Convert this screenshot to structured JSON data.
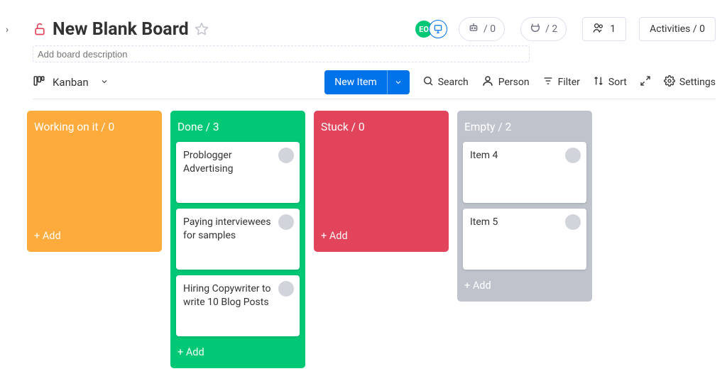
{
  "collapse": {
    "glyph": "›"
  },
  "header": {
    "title": "New Blank Board",
    "description_placeholder": "Add board description",
    "avatars": [
      {
        "initials": "EO"
      },
      {
        "icon": true
      }
    ],
    "automation_count": "/ 0",
    "integration_count": "/ 2",
    "members": {
      "label": "1"
    },
    "activities": {
      "label": "Activities / 0"
    }
  },
  "toolbar": {
    "view_label": "Kanban",
    "new_item_label": "New Item",
    "search_label": "Search",
    "person_label": "Person",
    "filter_label": "Filter",
    "sort_label": "Sort",
    "settings_label": "Settings"
  },
  "columns": [
    {
      "title": "Working on it / 0",
      "color": "col-orange",
      "cards": [],
      "add_label": "+ Add"
    },
    {
      "title": "Done / 3",
      "color": "col-green",
      "cards": [
        {
          "text": "Problogger Advertising"
        },
        {
          "text": "Paying interviewees for samples"
        },
        {
          "text": "Hiring Copywriter to write 10 Blog Posts"
        }
      ],
      "add_label": "+ Add"
    },
    {
      "title": "Stuck / 0",
      "color": "col-red",
      "cards": [],
      "add_label": "+ Add"
    },
    {
      "title": "Empty / 2",
      "color": "col-gray",
      "cards": [
        {
          "text": "Item 4"
        },
        {
          "text": "Item 5"
        }
      ],
      "add_label": "+ Add"
    }
  ]
}
